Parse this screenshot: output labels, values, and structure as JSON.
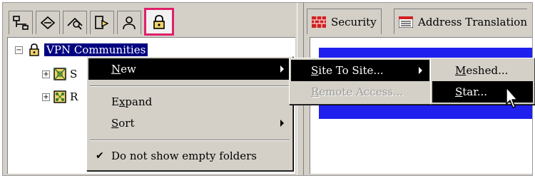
{
  "toolbar": {
    "tabs": [
      {
        "icon": "network-objects-icon"
      },
      {
        "icon": "services-icon"
      },
      {
        "icon": "resources-icon"
      },
      {
        "icon": "servers-icon"
      },
      {
        "icon": "users-icon"
      },
      {
        "icon": "vpn-lock-icon",
        "selected": true
      }
    ]
  },
  "tree": {
    "root_label": "VPN Communities",
    "child1_partial": "S",
    "child2_partial": "R"
  },
  "right_tabs": {
    "security": "Security",
    "address_translation": "Address Translation"
  },
  "context_menu": {
    "new": {
      "label": "New",
      "accel_prefix": "",
      "accel": "N",
      "rest": "ew"
    },
    "expand": {
      "pre": "E",
      "accel": "x",
      "rest": "pand"
    },
    "sort": {
      "pre": "",
      "accel": "S",
      "rest": "ort"
    },
    "dont_show": {
      "label": "Do not show empty folders",
      "checked": true
    }
  },
  "new_submenu": {
    "site_to_site": {
      "pre": "",
      "accel": "S",
      "rest": "ite To Site..."
    },
    "remote_access": {
      "pre": "",
      "accel": "R",
      "rest": "emote Access..."
    }
  },
  "site_submenu": {
    "meshed": {
      "pre": "",
      "accel": "M",
      "rest": "eshed..."
    },
    "star": {
      "pre": "",
      "accel": "S",
      "rest": "tar..."
    }
  },
  "colors": {
    "selection": "#000080",
    "menu_highlight": "#000000",
    "tab_highlight_border": "#e0206a",
    "grid_fill": "#2020ee"
  }
}
